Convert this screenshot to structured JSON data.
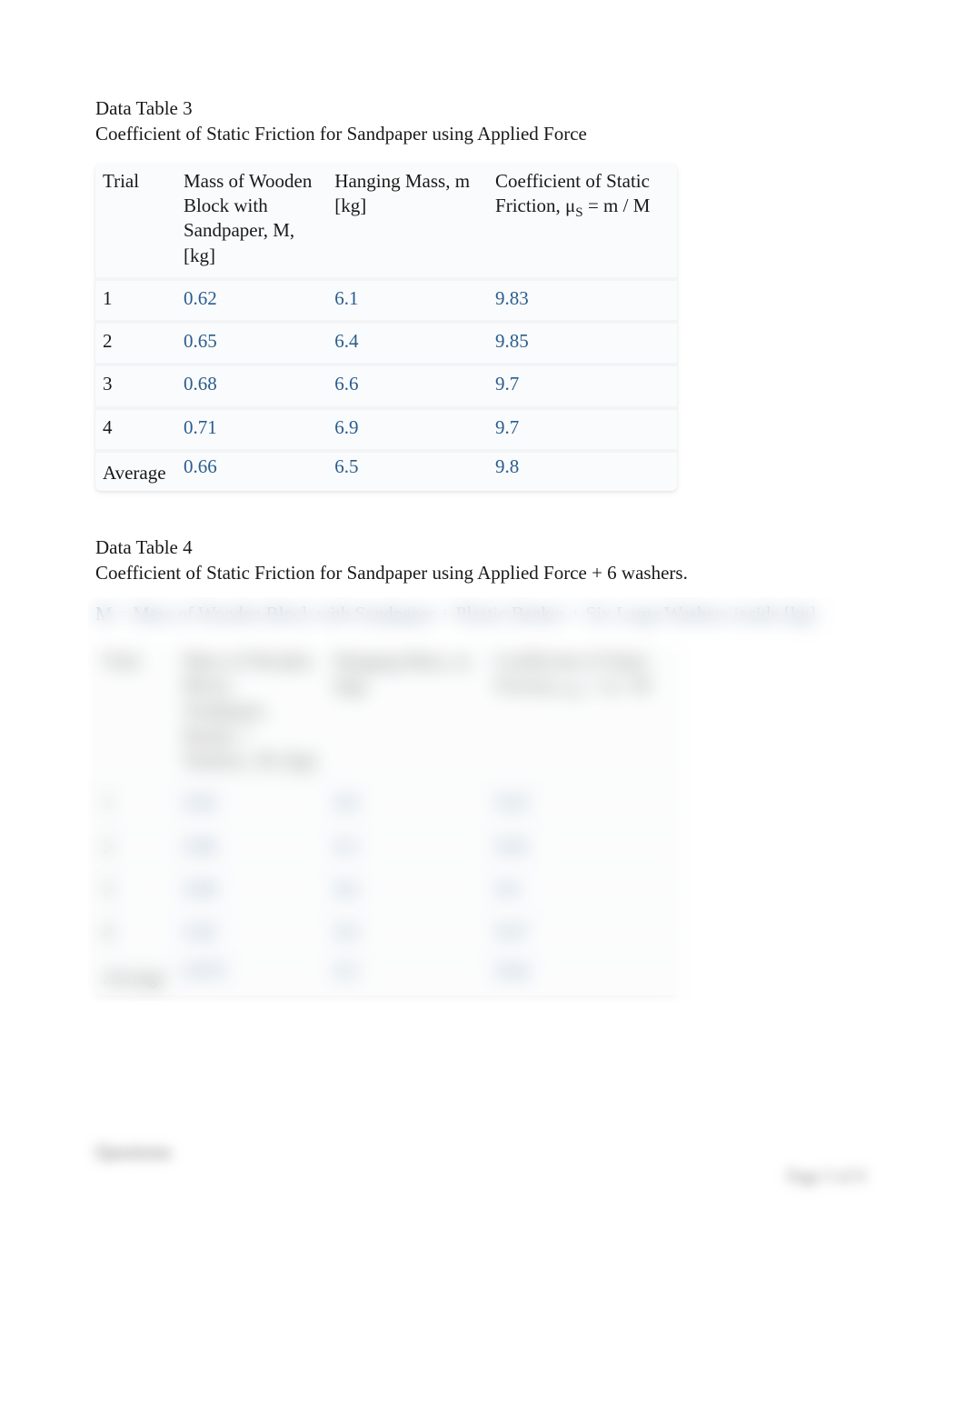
{
  "table3": {
    "title_line1": "Data Table 3",
    "title_line2": "Coefficient of Static Friction for Sandpaper using Applied Force",
    "headers": {
      "trial": "Trial",
      "mass_block": "Mass of Wooden Block with Sandpaper, M, [kg]",
      "hanging_mass": "Hanging Mass, m [kg]",
      "coeff_prefix": "Coefficient of Static Friction, μ",
      "coeff_sub": "S",
      "coeff_suffix": " = m / M"
    },
    "rows": [
      {
        "trial": "1",
        "M": "0.62",
        "m": "6.1",
        "mu": "9.83"
      },
      {
        "trial": "2",
        "M": "0.65",
        "m": "6.4",
        "mu": "9.85"
      },
      {
        "trial": "3",
        "M": "0.68",
        "m": "6.6",
        "mu": "9.7"
      },
      {
        "trial": "4",
        "M": "0.71",
        "m": "6.9",
        "mu": "9.7"
      }
    ],
    "average": {
      "label": "Average",
      "M": "0.66",
      "m": "6.5",
      "mu": "9.8"
    }
  },
  "table4": {
    "title_line1": "Data Table 4",
    "title_line2": "Coefficient of Static Friction for Sandpaper using Applied Force + 6 washers.",
    "m_line": "M = Mass of Wooden Block with Sandpaper + Plastic Beaker + Six Large Washers inside [kg]",
    "headers": {
      "trial": "Trial",
      "mass_block": "Mass of Wooden Block, Sandpaper, Beaker + Washers, M, [kg]",
      "hanging_mass": "Hanging Mass, m [kg]",
      "coeff_prefix": "Coefficient of Static Friction, μ",
      "coeff_sub": "S",
      "coeff_suffix": " = m / M"
    },
    "rows": [
      {
        "trial": "1",
        "M": "0.83",
        "m": "8.0",
        "mu": "9.63"
      },
      {
        "trial": "2",
        "M": "0.86",
        "m": "8.3",
        "mu": "9.65"
      },
      {
        "trial": "3",
        "M": "0.89",
        "m": "8.6",
        "mu": "9.6"
      },
      {
        "trial": "4",
        "M": "0.92",
        "m": "8.9",
        "mu": "9.67"
      }
    ],
    "average": {
      "label": "Average",
      "M": "0.875",
      "m": "8.5",
      "mu": "9.64"
    }
  },
  "questions_label": "Questions",
  "footer": "Page 5 of 9"
}
